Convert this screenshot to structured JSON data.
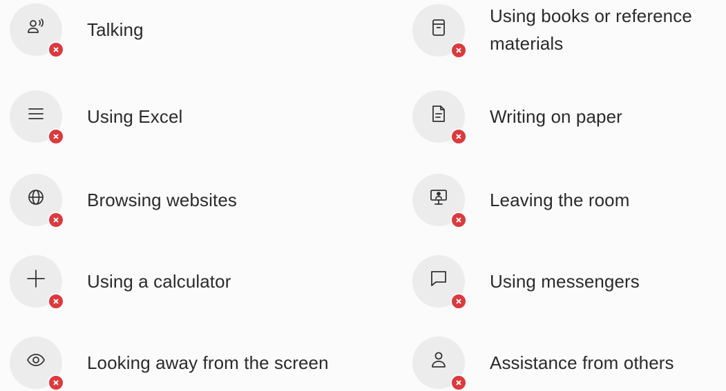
{
  "rules": [
    {
      "label": "Talking",
      "icon": "speaking-person-icon",
      "status": "not-allowed"
    },
    {
      "label": "Using Excel",
      "icon": "menu-lines-icon",
      "status": "not-allowed"
    },
    {
      "label": "Browsing websites",
      "icon": "globe-icon",
      "status": "not-allowed"
    },
    {
      "label": "Using a calculator",
      "icon": "plus-icon",
      "status": "not-allowed"
    },
    {
      "label": "Looking away from the screen",
      "icon": "eye-icon",
      "status": "not-allowed"
    },
    {
      "label": "Using books or reference materials",
      "icon": "book-icon",
      "status": "not-allowed"
    },
    {
      "label": "Writing on paper",
      "icon": "document-icon",
      "status": "not-allowed"
    },
    {
      "label": "Leaving the room",
      "icon": "presenter-screen-icon",
      "status": "not-allowed"
    },
    {
      "label": "Using messengers",
      "icon": "chat-bubble-icon",
      "status": "not-allowed"
    },
    {
      "label": "Assistance from others",
      "icon": "person-icon",
      "status": "not-allowed"
    }
  ],
  "colors": {
    "badge_background": "#ececec",
    "prohibited_mark": "#dc3a3e",
    "icon_stroke": "#333333",
    "text": "#2b2b2b"
  }
}
